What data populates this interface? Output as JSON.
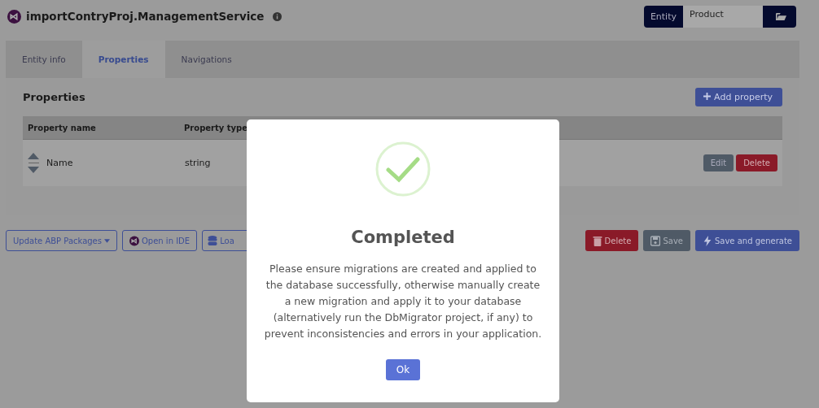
{
  "header": {
    "title": "importContryProj.ManagementService",
    "entity_selector": {
      "label": "Entity",
      "value": "Product"
    }
  },
  "tabs": [
    {
      "label": "Entity info",
      "selected": false
    },
    {
      "label": "Properties",
      "selected": true
    },
    {
      "label": "Navigations",
      "selected": false
    }
  ],
  "properties": {
    "heading": "Properties",
    "add_button": "Add property",
    "columns": [
      "Property name",
      "Property type"
    ],
    "rows": [
      {
        "name": "Name",
        "type": "string",
        "actions": [
          {
            "label": "Edit",
            "kind": "secondary"
          },
          {
            "label": "Delete",
            "kind": "danger"
          }
        ]
      }
    ]
  },
  "footer_buttons": [
    {
      "label": "Update ABP Packages",
      "kind": "dropdown"
    },
    {
      "label": "Open in IDE",
      "kind": "ide"
    },
    {
      "label": "Loa",
      "kind": "load"
    },
    {
      "label": "Delete",
      "kind": "delete"
    },
    {
      "label": "Save",
      "kind": "save"
    },
    {
      "label": "Save and generate",
      "kind": "generate"
    }
  ],
  "dialog": {
    "title": "Completed",
    "message": "Please ensure migrations are created and applied to the database successfully, otherwise manually create a new migration and apply it to your database (alternatively run the DbMigrator project, if any) to prevent inconsistencies and errors in your application.",
    "button": "Ok"
  }
}
